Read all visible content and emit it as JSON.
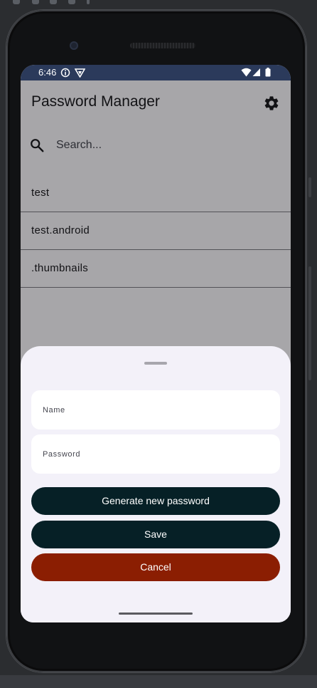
{
  "status_bar": {
    "time": "6:46",
    "icons": [
      "info-icon",
      "vpn-icon",
      "wifi-icon",
      "signal-icon",
      "battery-icon"
    ]
  },
  "app": {
    "title": "Password Manager",
    "settings_icon": "gear-icon"
  },
  "search": {
    "placeholder": "Search...",
    "icon": "search-icon"
  },
  "entries": [
    {
      "label": "test"
    },
    {
      "label": "test.android"
    },
    {
      "label": ".thumbnails"
    }
  ],
  "sheet": {
    "name_placeholder": "Name",
    "password_placeholder": "Password",
    "generate_label": "Generate new password",
    "save_label": "Save",
    "cancel_label": "Cancel"
  },
  "colors": {
    "status_bar": "#2b3a5b",
    "primary_button": "#062026",
    "cancel_button": "#8b1e02",
    "sheet_background": "#f3f1f9"
  }
}
